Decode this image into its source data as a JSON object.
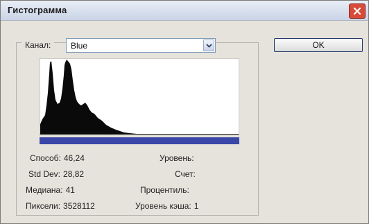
{
  "window": {
    "title": "Гистограмма",
    "close_icon": "close-icon"
  },
  "channel": {
    "label": "Канал:",
    "value": "Blue"
  },
  "ok_label": "OK",
  "histogram": {
    "bar_color": "#3a46a8"
  },
  "stats_left": [
    {
      "label": "Способ:",
      "value": "46,24"
    },
    {
      "label": "Std Dev:",
      "value": "28,82"
    },
    {
      "label": "Медиана:",
      "value": "41"
    },
    {
      "label": "Пиксели:",
      "value": "3528112"
    }
  ],
  "stats_right": [
    {
      "label": "Уровень:",
      "value": ""
    },
    {
      "label": "Счет:",
      "value": ""
    },
    {
      "label": "Процентиль:",
      "value": ""
    },
    {
      "label": "Уровень кэша:",
      "value": "1"
    }
  ]
}
